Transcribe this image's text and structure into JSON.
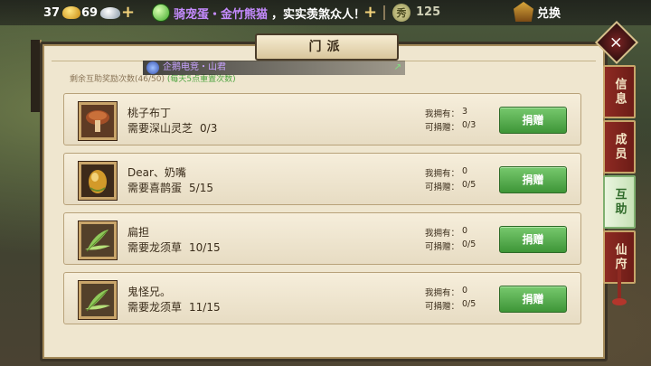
{
  "topbar": {
    "gold": "37",
    "silver": "69",
    "plus_symbol": "+",
    "ticker_highlight": "骑宠蛋・金竹熊猫",
    "ticker_text": "，实实羡煞众人！",
    "jade_glyph": "秀",
    "jade_value": "125",
    "exchange_label": "兑换"
  },
  "panel": {
    "title": "门派",
    "remain_prefix": "剩余互助奖励次数(46/50)",
    "remain_note": "(每天5点重置次数)",
    "broadcast": "企鹅电竞・山君",
    "close_symbol": "×"
  },
  "labels": {
    "owned": "我拥有：",
    "can_donate": "可捐赠：",
    "need_prefix": "需要",
    "donate_button": "捐赠"
  },
  "requests": [
    {
      "requester": "桃子布丁",
      "item": "深山灵芝",
      "progress": "0/3",
      "owned": "3",
      "can_donate": "0/3",
      "icon": "mushroom-icon"
    },
    {
      "requester": "Dear、奶嘴",
      "item": "喜鹊蛋",
      "progress": "5/15",
      "owned": "0",
      "can_donate": "0/5",
      "icon": "egg-icon"
    },
    {
      "requester": "扁担",
      "item": "龙须草",
      "progress": "10/15",
      "owned": "0",
      "can_donate": "0/5",
      "icon": "herb-icon"
    },
    {
      "requester": "鬼怪兄。",
      "item": "龙须草",
      "progress": "11/15",
      "owned": "0",
      "can_donate": "0/5",
      "icon": "herb-icon"
    }
  ],
  "side_tabs": [
    {
      "label": "信息",
      "active": false
    },
    {
      "label": "成员",
      "active": false
    },
    {
      "label": "互助",
      "active": true
    },
    {
      "label": "仙府",
      "active": false
    }
  ],
  "colors": {
    "donate_green": "#4fae45",
    "tab_red": "#8e2a22",
    "panel_bg": "#efe6cf"
  }
}
